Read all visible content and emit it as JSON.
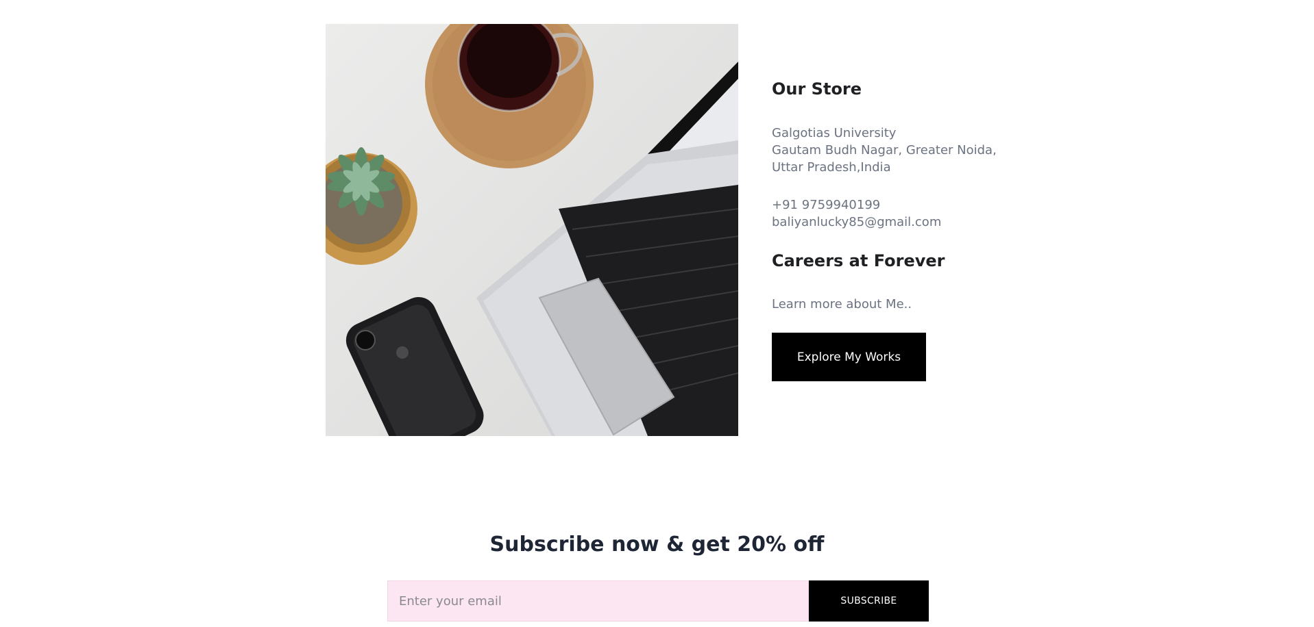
{
  "store": {
    "heading": "Our Store",
    "address_lines": [
      "Galgotias University",
      "Gautam Budh Nagar, Greater Noida,",
      "Uttar Pradesh,India"
    ],
    "phone": "+91 9759940199",
    "email": "baliyanlucky85@gmail.com"
  },
  "careers": {
    "heading": "Careers at Forever",
    "text": "Learn more about Me..",
    "button_label": "Explore My Works"
  },
  "subscribe": {
    "title": "Subscribe now & get 20% off",
    "placeholder": "Enter your email",
    "button_label": "SUBSCRIBE"
  },
  "colors": {
    "button_bg": "#000000",
    "input_bg": "#fce6f2",
    "muted_text": "#6b7280"
  }
}
